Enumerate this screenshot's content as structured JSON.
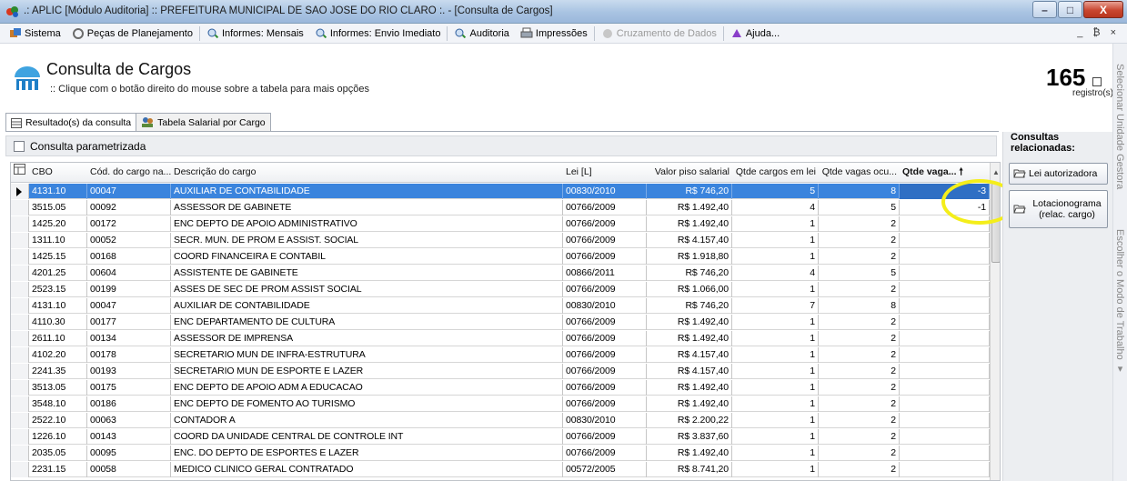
{
  "window": {
    "title": ".: APLIC [Módulo Auditoria] :: PREFEITURA MUNICIPAL DE SAO JOSE DO RIO CLARO :. - [Consulta de Cargos]",
    "minimize": "–",
    "maximize": "□",
    "close": "X"
  },
  "menu": {
    "items": [
      {
        "label": "Sistema",
        "icon": "system-icon"
      },
      {
        "label": "Peças de Planejamento",
        "icon": "planning-icon"
      },
      {
        "label": "Informes: Mensais",
        "icon": "monthly-reports-icon"
      },
      {
        "label": "Informes: Envio Imediato",
        "icon": "immediate-reports-icon"
      },
      {
        "label": "Auditoria",
        "icon": "audit-icon"
      },
      {
        "label": "Impressões",
        "icon": "printer-icon"
      },
      {
        "label": "Cruzamento de Dados",
        "icon": "data-crossing-icon",
        "disabled": true
      },
      {
        "label": "Ajuda...",
        "icon": "help-icon"
      }
    ],
    "right_controls": "_ ₿ ×"
  },
  "header": {
    "title": "Consulta de Cargos",
    "subtitle": ":: Clique com o botão direito do mouse sobre a tabela para mais opções",
    "record_count": "165",
    "record_label": "registro(s)"
  },
  "side_strip": {
    "text1": "Selecionar Unidade Gestora",
    "text2": "Escolher o Modo de Trabalho ▾"
  },
  "tabs": [
    {
      "label": "Resultado(s) da consulta",
      "icon": "grid-icon"
    },
    {
      "label": "Tabela Salarial por Cargo",
      "icon": "users-icon"
    }
  ],
  "param": {
    "label": "Consulta parametrizada"
  },
  "grid": {
    "columns": [
      "CBO",
      "Cód. do cargo na...",
      "Descrição do cargo",
      "Lei [L]",
      "Valor piso salarial",
      "Qtde cargos em lei",
      "Qtde vagas ocu...",
      "Qtde vaga... 🠕"
    ],
    "rows": [
      [
        "4131.10",
        "00047",
        "AUXILIAR DE CONTABILIDADE",
        "00830/2010",
        "R$ 746,20",
        "5",
        "8",
        "-3"
      ],
      [
        "3515.05",
        "00092",
        "ASSESSOR DE GABINETE",
        "00766/2009",
        "R$ 1.492,40",
        "4",
        "5",
        "-1"
      ],
      [
        "1425.20",
        "00172",
        "ENC DEPTO DE APOIO ADMINISTRATIVO",
        "00766/2009",
        "R$ 1.492,40",
        "1",
        "2",
        ""
      ],
      [
        "1311.10",
        "00052",
        "SECR. MUN. DE PROM E ASSIST. SOCIAL",
        "00766/2009",
        "R$ 4.157,40",
        "1",
        "2",
        ""
      ],
      [
        "1425.15",
        "00168",
        "COORD FINANCEIRA E CONTABIL",
        "00766/2009",
        "R$ 1.918,80",
        "1",
        "2",
        ""
      ],
      [
        "4201.25",
        "00604",
        "ASSISTENTE DE GABINETE",
        "00866/2011",
        "R$ 746,20",
        "4",
        "5",
        ""
      ],
      [
        "2523.15",
        "00199",
        "ASSES DE SEC DE PROM ASSIST SOCIAL",
        "00766/2009",
        "R$ 1.066,00",
        "1",
        "2",
        ""
      ],
      [
        "4131.10",
        "00047",
        "AUXILIAR DE CONTABILIDADE",
        "00830/2010",
        "R$ 746,20",
        "7",
        "8",
        ""
      ],
      [
        "4110.30",
        "00177",
        "ENC DEPARTAMENTO DE CULTURA",
        "00766/2009",
        "R$ 1.492,40",
        "1",
        "2",
        ""
      ],
      [
        "2611.10",
        "00134",
        "ASSESSOR DE IMPRENSA",
        "00766/2009",
        "R$ 1.492,40",
        "1",
        "2",
        ""
      ],
      [
        "4102.20",
        "00178",
        "SECRETARIO MUN DE INFRA-ESTRUTURA",
        "00766/2009",
        "R$ 4.157,40",
        "1",
        "2",
        ""
      ],
      [
        "2241.35",
        "00193",
        "SECRETARIO MUN DE ESPORTE E LAZER",
        "00766/2009",
        "R$ 4.157,40",
        "1",
        "2",
        ""
      ],
      [
        "3513.05",
        "00175",
        "ENC DEPTO DE APOIO ADM A EDUCACAO",
        "00766/2009",
        "R$ 1.492,40",
        "1",
        "2",
        ""
      ],
      [
        "3548.10",
        "00186",
        "ENC DEPTO DE FOMENTO AO TURISMO",
        "00766/2009",
        "R$ 1.492,40",
        "1",
        "2",
        ""
      ],
      [
        "2522.10",
        "00063",
        "CONTADOR  A",
        "00830/2010",
        "R$ 2.200,22",
        "1",
        "2",
        ""
      ],
      [
        "1226.10",
        "00143",
        "COORD DA UNIDADE CENTRAL DE CONTROLE INT",
        "00766/2009",
        "R$ 3.837,60",
        "1",
        "2",
        ""
      ],
      [
        "2035.05",
        "00095",
        "ENC. DO DEPTO DE ESPORTES E LAZER",
        "00766/2009",
        "R$ 1.492,40",
        "1",
        "2",
        ""
      ],
      [
        "2231.15",
        "00058",
        "MEDICO CLINICO GERAL  CONTRATADO",
        "00572/2005",
        "R$ 8.741,20",
        "1",
        "2",
        ""
      ]
    ]
  },
  "side_panel": {
    "title": "Consultas relacionadas:",
    "buttons": [
      {
        "label": "Lei autorizadora",
        "icon": "folder-open-icon"
      },
      {
        "label": "Lotacionograma (relac. cargo)",
        "icon": "folder-open-icon"
      }
    ]
  },
  "colors": {
    "selection": "#3a84dd",
    "highlight_ring": "#f4ee1a"
  }
}
